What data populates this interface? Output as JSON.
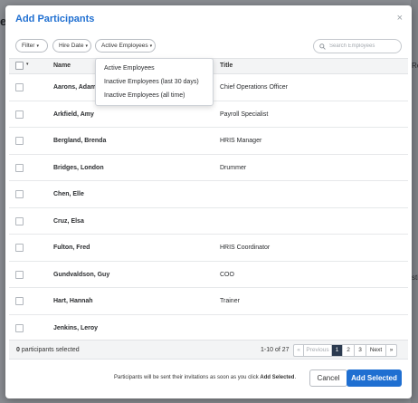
{
  "backdrop": {
    "left_glyph": "e",
    "right_texts": [
      "Re",
      "stic"
    ]
  },
  "modal": {
    "title": "Add Participants",
    "close_glyph": "×"
  },
  "filters": {
    "filter_label": "Filter",
    "hire_date_label": "Hire Date",
    "status_label": "Active Employees",
    "caret": "▾"
  },
  "search": {
    "placeholder": "Search Employees",
    "value": ""
  },
  "dropdown": {
    "options": [
      "Active Employees",
      "Inactive Employees (last 30 days)",
      "Inactive Employees (all time)"
    ]
  },
  "table": {
    "columns": {
      "name": "Name",
      "title": "Title"
    },
    "rows": [
      {
        "name": "Aarons, Adam",
        "title": "Chief Operations Officer"
      },
      {
        "name": "Arkfield, Amy",
        "title": "Payroll Specialist"
      },
      {
        "name": "Bergland, Brenda",
        "title": "HRIS Manager"
      },
      {
        "name": "Bridges, London",
        "title": "Drummer"
      },
      {
        "name": "Chen, Elle",
        "title": ""
      },
      {
        "name": "Cruz, Elsa",
        "title": ""
      },
      {
        "name": "Fulton, Fred",
        "title": "HRIS Coordinator"
      },
      {
        "name": "Gundvaldson, Guy",
        "title": "COO"
      },
      {
        "name": "Hart, Hannah",
        "title": "Trainer"
      },
      {
        "name": "Jenkins, Leroy",
        "title": ""
      }
    ]
  },
  "footer": {
    "selected_count": "0",
    "selected_text": "participants selected",
    "range": "1-10 of 27",
    "pager": {
      "first": "«",
      "previous": "Previous",
      "pages": [
        "1",
        "2",
        "3"
      ],
      "current_page": "1",
      "next": "Next",
      "last": "»"
    }
  },
  "actions": {
    "notice_prefix": "Participants will be sent their invitations as soon as you click",
    "notice_action": "Add Selected",
    "notice_suffix": ".",
    "cancel_label": "Cancel",
    "add_label": "Add Selected"
  },
  "colors": {
    "accent": "#1f6fd1",
    "active_page": "#2b3a4f"
  },
  "icons": {
    "search": "search-icon",
    "close": "close-icon",
    "caret": "chevron-down-icon"
  }
}
